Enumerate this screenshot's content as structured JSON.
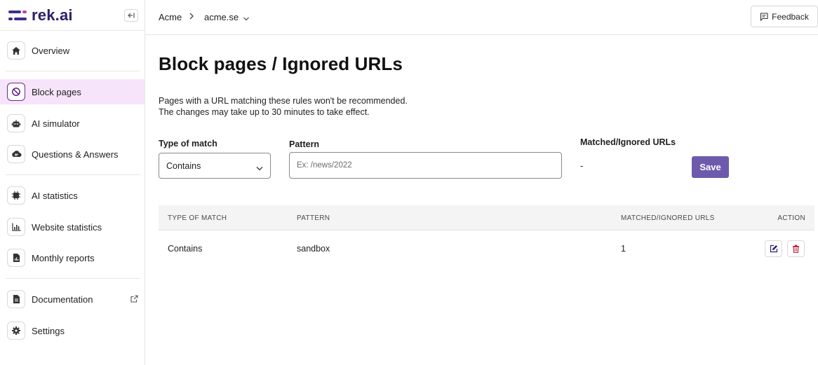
{
  "brand": {
    "name": "rek.ai",
    "collapse_icon": "collapse-sidebar-icon"
  },
  "sidebar": {
    "items": [
      {
        "label": "Overview",
        "icon": "home-icon"
      },
      {
        "label": "Block pages",
        "icon": "block-icon",
        "active": true
      },
      {
        "label": "AI simulator",
        "icon": "robot-icon"
      },
      {
        "label": "Questions & Answers",
        "icon": "cloud-chat-icon"
      },
      {
        "label": "AI statistics",
        "icon": "chip-icon"
      },
      {
        "label": "Website statistics",
        "icon": "bar-chart-icon"
      },
      {
        "label": "Monthly reports",
        "icon": "report-icon"
      },
      {
        "label": "Documentation",
        "icon": "document-icon",
        "external_icon": "external-link-icon"
      },
      {
        "label": "Settings",
        "icon": "gear-icon"
      }
    ]
  },
  "header": {
    "breadcrumb": [
      "Acme",
      "acme.se"
    ],
    "feedback_label": "Feedback"
  },
  "main": {
    "title": "Block pages / Ignored URLs",
    "description_line1": "Pages with a URL matching these rules won't be recommended.",
    "description_line2": "The changes may take up to 30 minutes to take effect.",
    "form": {
      "type_label": "Type of match",
      "type_value": "Contains",
      "pattern_label": "Pattern",
      "pattern_placeholder": "Ex: /news/2022",
      "matched_label": "Matched/Ignored URLs",
      "matched_value": "-",
      "save_label": "Save"
    },
    "table": {
      "headers": [
        "TYPE OF MATCH",
        "PATTERN",
        "MATCHED/IGNORED URLS",
        "ACTION"
      ],
      "rows": [
        {
          "type": "Contains",
          "pattern": "sandbox",
          "matched": "1",
          "actions": [
            "edit-icon",
            "delete-icon"
          ]
        }
      ]
    }
  },
  "colors": {
    "accent": "#6e5aad",
    "brand": "#2a2169",
    "active_bg": "#f6e4fa",
    "danger": "#c0263a"
  }
}
